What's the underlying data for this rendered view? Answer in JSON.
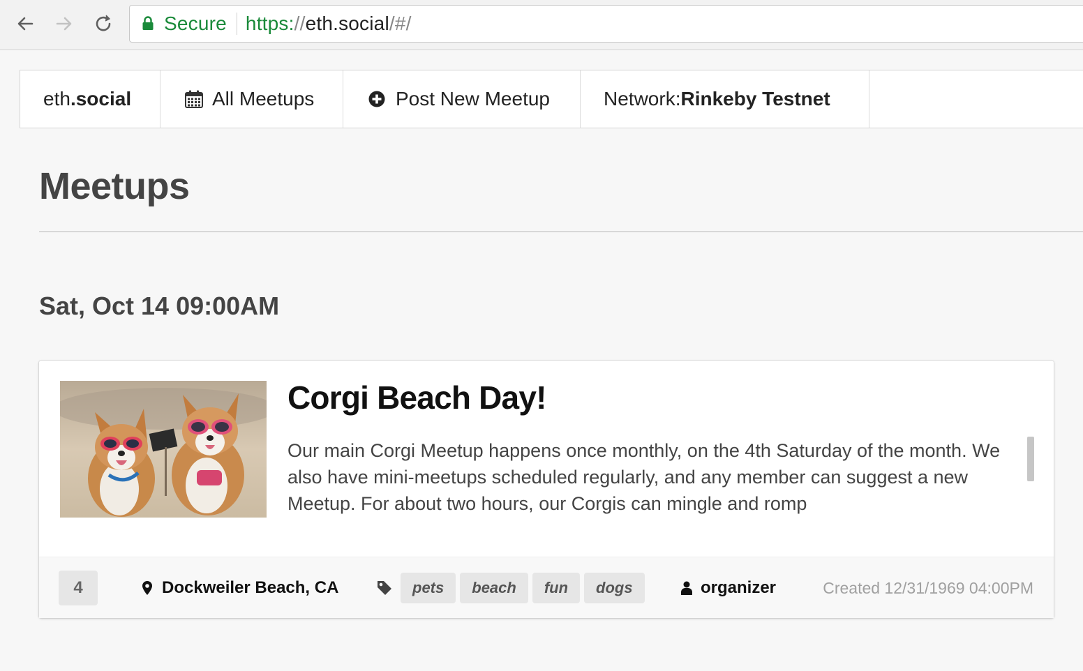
{
  "browser": {
    "secure_label": "Secure",
    "url": {
      "scheme": "https:",
      "slashes": "//",
      "host": "eth.social",
      "path": "/#/"
    }
  },
  "menu": {
    "brand_prefix": "eth",
    "brand_suffix": ".social",
    "all_meetups": "All Meetups",
    "post_new_meetup": "Post New Meetup",
    "network_label": "Network:",
    "network_value": "Rinkeby Testnet"
  },
  "page": {
    "title": "Meetups"
  },
  "event_group": {
    "date": "Sat, Oct 14",
    "time": "09:00AM"
  },
  "meetup": {
    "title": "Corgi Beach Day!",
    "description": "Our main Corgi Meetup happens once monthly, on the 4th Saturday of the month. We also have mini-meetups scheduled regularly, and any member can suggest a new Meetup. For about two hours, our Corgis can mingle and romp",
    "count": "4",
    "location": "Dockweiler Beach, CA",
    "tags": [
      "pets",
      "beach",
      "fun",
      "dogs"
    ],
    "organizer": "organizer",
    "created": "Created 12/31/1969 04:00PM"
  },
  "icons": {
    "back": "arrow-left-icon",
    "forward": "arrow-right-icon",
    "reload": "reload-icon",
    "lock": "lock-icon",
    "calendar": "calendar-icon",
    "plus_circle": "plus-circle-icon",
    "map_marker": "map-marker-icon",
    "tag": "tag-icon",
    "user": "user-icon"
  },
  "colors": {
    "secure_green": "#1a8a3a",
    "background": "#f7f7f7",
    "tag_bg": "#e6e6e6"
  }
}
